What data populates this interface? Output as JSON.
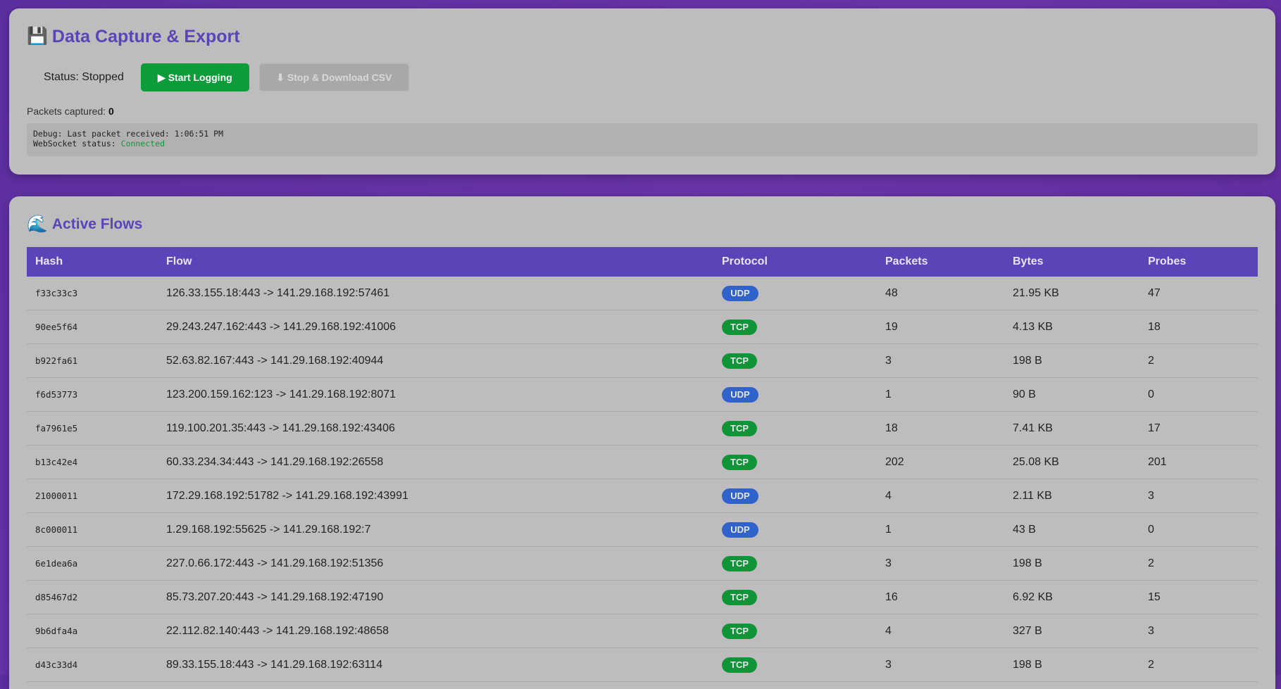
{
  "capture": {
    "icon": "floppy-disk-icon",
    "title": "Data Capture & Export",
    "status_text": "Status: Stopped",
    "start_label": "▶ Start Logging",
    "stop_label": "⬇ Stop & Download CSV",
    "packets_label": "Packets captured: ",
    "packets_count": "0",
    "debug_line1": "Debug: Last packet received: 1:06:51 PM",
    "ws_label": "WebSocket status: ",
    "ws_status": "Connected"
  },
  "flows": {
    "icon": "wave-icon",
    "title": "Active Flows",
    "columns": [
      "Hash",
      "Flow",
      "Protocol",
      "Packets",
      "Bytes",
      "Probes"
    ],
    "rows": [
      {
        "hash": "f33c33c3",
        "flow": "126.33.155.18:443 -> 141.29.168.192:57461",
        "protocol": "UDP",
        "packets": "48",
        "bytes": "21.95 KB",
        "probes": "47"
      },
      {
        "hash": "90ee5f64",
        "flow": "29.243.247.162:443 -> 141.29.168.192:41006",
        "protocol": "TCP",
        "packets": "19",
        "bytes": "4.13 KB",
        "probes": "18"
      },
      {
        "hash": "b922fa61",
        "flow": "52.63.82.167:443 -> 141.29.168.192:40944",
        "protocol": "TCP",
        "packets": "3",
        "bytes": "198 B",
        "probes": "2"
      },
      {
        "hash": "f6d53773",
        "flow": "123.200.159.162:123 -> 141.29.168.192:8071",
        "protocol": "UDP",
        "packets": "1",
        "bytes": "90 B",
        "probes": "0"
      },
      {
        "hash": "fa7961e5",
        "flow": "119.100.201.35:443 -> 141.29.168.192:43406",
        "protocol": "TCP",
        "packets": "18",
        "bytes": "7.41 KB",
        "probes": "17"
      },
      {
        "hash": "b13c42e4",
        "flow": "60.33.234.34:443 -> 141.29.168.192:26558",
        "protocol": "TCP",
        "packets": "202",
        "bytes": "25.08 KB",
        "probes": "201"
      },
      {
        "hash": "21000011",
        "flow": "172.29.168.192:51782 -> 141.29.168.192:43991",
        "protocol": "UDP",
        "packets": "4",
        "bytes": "2.11 KB",
        "probes": "3"
      },
      {
        "hash": "8c000011",
        "flow": "1.29.168.192:55625 -> 141.29.168.192:7",
        "protocol": "UDP",
        "packets": "1",
        "bytes": "43 B",
        "probes": "0"
      },
      {
        "hash": "6e1dea6a",
        "flow": "227.0.66.172:443 -> 141.29.168.192:51356",
        "protocol": "TCP",
        "packets": "3",
        "bytes": "198 B",
        "probes": "2"
      },
      {
        "hash": "d85467d2",
        "flow": "85.73.207.20:443 -> 141.29.168.192:47190",
        "protocol": "TCP",
        "packets": "16",
        "bytes": "6.92 KB",
        "probes": "15"
      },
      {
        "hash": "9b6dfa4a",
        "flow": "22.112.82.140:443 -> 141.29.168.192:48658",
        "protocol": "TCP",
        "packets": "4",
        "bytes": "327 B",
        "probes": "3"
      },
      {
        "hash": "d43c33d4",
        "flow": "89.33.155.18:443 -> 141.29.168.192:63114",
        "protocol": "TCP",
        "packets": "3",
        "bytes": "198 B",
        "probes": "2"
      }
    ]
  },
  "colors": {
    "accent": "#5b44b8",
    "tcp": "#119437",
    "udp": "#2f63c9",
    "start_button": "#0e9b3a"
  }
}
